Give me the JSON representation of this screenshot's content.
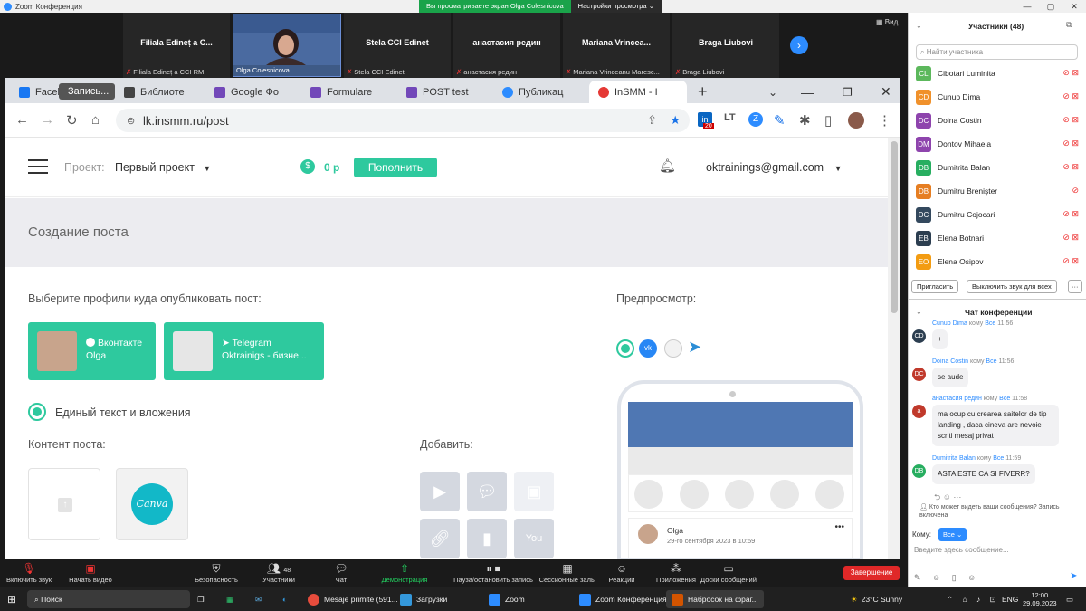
{
  "zoom": {
    "title": "Zoom Конференция",
    "share_banner": "Вы просматриваете экран Olga Colesnicova",
    "view_settings": "Настройки просмотра",
    "view_btn": "Вид",
    "strip_tiles": [
      {
        "name": "Filiala Edineț a C...",
        "label": "Filiala Edineț a CCI RM"
      },
      {
        "name": "",
        "label": "Olga Colesnicova"
      },
      {
        "name": "Stela CCI Edinet",
        "label": "Stela CCI Edinet"
      },
      {
        "name": "анастасия редин",
        "label": "анастасия редин"
      },
      {
        "name": "Mariana Vrinceа...",
        "label": "Mariana Vrinceanu Maresc..."
      },
      {
        "name": "Braga Liubovi",
        "label": "Braga Liubovi"
      }
    ],
    "toolbar": {
      "audio": "Включить звук",
      "video": "Начать видео",
      "security": "Безопасность",
      "participants": "Участники",
      "participants_count": "48",
      "chat": "Чат",
      "share": "Демонстрация экрана",
      "record": "Пауза/остановить запись",
      "breakout": "Сессионные залы",
      "reactions": "Реакции",
      "apps": "Приложения",
      "whiteboards": "Доски сообщений",
      "end": "Завершение"
    },
    "participants_panel": {
      "title": "Участники (48)",
      "search_placeholder": "Найти участника",
      "invite": "Пригласить",
      "mute_all": "Выключить звук для всех",
      "list": [
        {
          "initials": "CL",
          "name": "Cibotari Luminita",
          "color": "#5cb85c"
        },
        {
          "initials": "CD",
          "name": "Cunup Dima",
          "color": "#f0912b"
        },
        {
          "initials": "DC",
          "name": "Doina Costin",
          "color": "#8e44ad"
        },
        {
          "initials": "DM",
          "name": "Dontov Mihaela",
          "color": "#8e44ad"
        },
        {
          "initials": "DB",
          "name": "Dumitrita Balan",
          "color": "#27ae60"
        },
        {
          "initials": "DB",
          "name": "Dumitru Brenișter",
          "color": "#e67e22"
        },
        {
          "initials": "DC",
          "name": "Dumitru Cojocari",
          "color": "#34495e"
        },
        {
          "initials": "EB",
          "name": "Elena Botnari",
          "color": "#2c3e50"
        },
        {
          "initials": "EO",
          "name": "Elena Osipov",
          "color": "#f39c12"
        }
      ]
    },
    "chat": {
      "title": "Чат конференции",
      "to_label": "кому",
      "everyone": "Все",
      "messages": [
        {
          "initials": "CD",
          "sender": "Cunup Dima",
          "time": "11:56",
          "text": "+",
          "color": "#2c3e50"
        },
        {
          "initials": "DC",
          "sender": "Doina Costin",
          "time": "11:56",
          "text": "se aude",
          "color": "#c0392b"
        },
        {
          "initials": "a",
          "sender": "анастасия редин",
          "time": "11:58",
          "text": "ma ocup cu crearea saitelor de tip landing , daca cineva are nevoie scriti mesaj privat",
          "color": "#c0392b"
        },
        {
          "initials": "DB",
          "sender": "Dumitrita Balan",
          "time": "11:59",
          "text": "ASTA ESTE CA SI FIVERR?",
          "color": "#27ae60"
        }
      ],
      "notice": "Кто может видеть ваши сообщения? Запись включена",
      "to_prefix": "Кому:",
      "to_value": "Все",
      "input_placeholder": "Введите здесь сообщение..."
    }
  },
  "browser": {
    "tabs": [
      {
        "label": "Faceb",
        "color": "#1877f2"
      },
      {
        "label": "Запись...",
        "color": "#555"
      },
      {
        "label": "Библиоте",
        "color": "#444"
      },
      {
        "label": "Google Фо",
        "color": "#7248b9"
      },
      {
        "label": "Formulare",
        "color": "#7248b9"
      },
      {
        "label": "POST test",
        "color": "#7248b9"
      },
      {
        "label": "Публикац",
        "color": "#2d8cff"
      },
      {
        "label": "InSMM - I",
        "color": "#e53935"
      }
    ],
    "url": "lk.insmm.ru/post",
    "ext_badge": "20"
  },
  "page": {
    "project_label": "Проект:",
    "project_name": "Первый проект",
    "balance": "0 р",
    "topup": "Пополнить",
    "account": "oktrainings@gmail.com",
    "section_title": "Создание поста",
    "choose_profiles": "Выберите профили куда опубликовать пост:",
    "preview_label": "Предпросмотр:",
    "profiles": [
      {
        "network": "Вконтакте",
        "name": "Olga"
      },
      {
        "network": "Telegram",
        "name": "Oktrainigs - бизне..."
      }
    ],
    "single_text": "Единый текст и вложения",
    "content_label": "Контент поста:",
    "add_label": "Добавить:",
    "canva": "Canva",
    "preview_user": "Olga",
    "preview_date": "29-го сентября 2023 в 10:59"
  },
  "taskbar": {
    "search": "Поиск",
    "apps": [
      {
        "label": "Mesaje primite (591...",
        "color": "#e74c3c"
      },
      {
        "label": "Загрузки",
        "color": "#3498db"
      },
      {
        "label": "Zoom",
        "color": "#2d8cff"
      },
      {
        "label": "Zoom Конференция",
        "color": "#2d8cff"
      },
      {
        "label": "Набросок на фраг...",
        "color": "#d35400"
      }
    ],
    "weather": "23°C  Sunny",
    "lang": "ENG",
    "time": "12:00",
    "date": "29.09.2023"
  }
}
